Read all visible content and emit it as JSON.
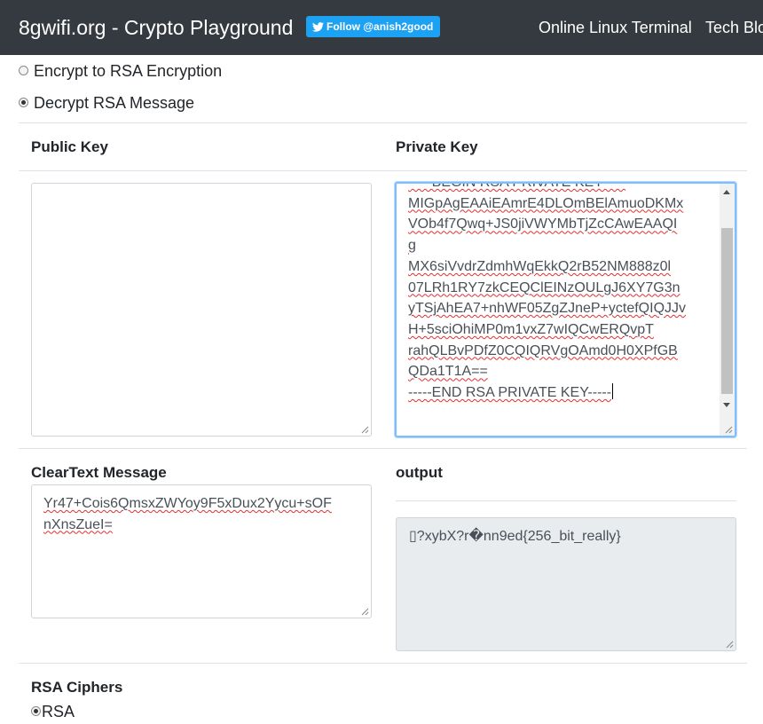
{
  "navbar": {
    "brand": "8gwifi.org - Crypto Playground",
    "follow_button": "Follow @anish2good",
    "links": [
      "Online Linux Terminal",
      "Tech Blo"
    ]
  },
  "mode": {
    "options": [
      {
        "label": "Encrypt to RSA Encryption",
        "checked": false
      },
      {
        "label": "Decrypt RSA Message",
        "checked": true
      }
    ]
  },
  "keys": {
    "public_label": "Public Key",
    "private_label": "Private Key",
    "public_value": "",
    "private_lines": [
      "-----BEGIN RSA PRIVATE KEY-----",
      "MIGpAgEAAiEAmrE4DLOmBElAmuoDKMx",
      "VOb4f7Qwq+JS0jiVWYMbTjZcCAwEAAQI",
      "g",
      "MX6siVvdrZdmhWqEkkQ2rB52NM888z0l",
      "07LRh1RY7zkCEQClEINzOULgJ6XY7G3n",
      "yTSjAhEA7+nhWF05ZgZJneP+yctefQIQJJv",
      "H+5sciOhiMP0m1vxZ7wIQCwERQvpT",
      "rahQLBvPDfZ0CQIQRVgOAmd0H0XPfGB",
      "QDa1T1A==",
      "-----END RSA PRIVATE KEY-----"
    ]
  },
  "message": {
    "cleartext_label": "ClearText Message",
    "output_label": "output",
    "cleartext_lines": [
      "Yr47+Cois6QmsxZWYoy9F5xDux2Yycu+sOF",
      "nXnsZueI="
    ],
    "output_value": "▯?xybX?r�nn9ed{256_bit_really}"
  },
  "ciphers": {
    "label": "RSA Ciphers",
    "options": [
      {
        "label": "RSA",
        "checked": true
      }
    ]
  },
  "colors": {
    "navbar_bg": "#343a40",
    "twitter_blue": "#1da1f2",
    "focus_border": "#80bdff",
    "readonly_bg": "#e9ecef"
  }
}
